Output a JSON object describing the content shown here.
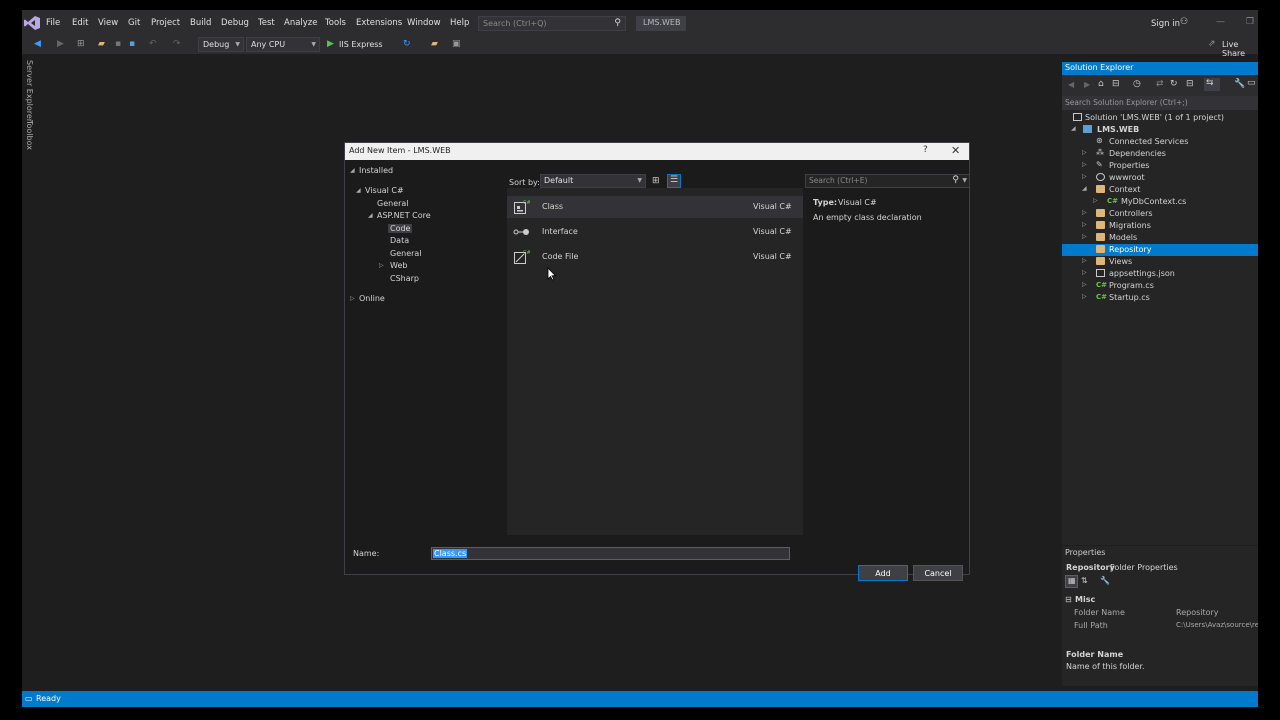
{
  "menubar": {
    "items": [
      "File",
      "Edit",
      "View",
      "Git",
      "Project",
      "Build",
      "Debug",
      "Test",
      "Analyze",
      "Tools",
      "Extensions",
      "Window",
      "Help"
    ],
    "search_placeholder": "Search (Ctrl+Q)",
    "solution_name": "LMS.WEB",
    "sign_in": "Sign in"
  },
  "toolbar": {
    "config": "Debug",
    "platform": "Any CPU",
    "run_target": "IIS Express",
    "live_share": "Live Share"
  },
  "side_tabs": [
    "Server Explorer",
    "Toolbox"
  ],
  "solution_explorer": {
    "title": "Solution Explorer",
    "search_placeholder": "Search Solution Explorer (Ctrl+;)",
    "solution": "Solution 'LMS.WEB' (1 of 1 project)",
    "project": "LMS.WEB",
    "items": [
      {
        "label": "Connected Services",
        "icon": "connected-services-icon"
      },
      {
        "label": "Dependencies",
        "icon": "dependencies-icon"
      },
      {
        "label": "Properties",
        "icon": "wrench-icon"
      },
      {
        "label": "wwwroot",
        "icon": "globe-icon"
      },
      {
        "label": "Context",
        "icon": "folder-icon"
      },
      {
        "label": "MyDbContext.cs",
        "icon": "csharp-file-icon"
      },
      {
        "label": "Controllers",
        "icon": "folder-icon"
      },
      {
        "label": "Migrations",
        "icon": "folder-icon"
      },
      {
        "label": "Models",
        "icon": "folder-icon"
      },
      {
        "label": "Repository",
        "icon": "folder-icon"
      },
      {
        "label": "Views",
        "icon": "folder-icon"
      },
      {
        "label": "appsettings.json",
        "icon": "json-file-icon"
      },
      {
        "label": "Program.cs",
        "icon": "csharp-file-icon"
      },
      {
        "label": "Startup.cs",
        "icon": "csharp-file-icon"
      }
    ],
    "selected": "Repository"
  },
  "properties": {
    "title": "Properties",
    "object": "Repository",
    "object_type": "Folder Properties",
    "category": "Misc",
    "rows": [
      {
        "name": "Folder Name",
        "value": "Repository"
      },
      {
        "name": "Full Path",
        "value": "C:\\Users\\Avaz\\source\\re"
      }
    ],
    "desc_title": "Folder Name",
    "desc_text": "Name of this folder."
  },
  "status": {
    "text": "Ready"
  },
  "dialog": {
    "title": "Add New Item - LMS.WEB",
    "help": "?",
    "close": "✕",
    "tree": {
      "installed": "Installed",
      "visual_csharp": "Visual C#",
      "general": "General",
      "aspnet_core": "ASP.NET Core",
      "code": "Code",
      "data": "Data",
      "general2": "General",
      "web": "Web",
      "csharp": "CSharp",
      "online": "Online"
    },
    "sort_by_label": "Sort by:",
    "sort_by_value": "Default",
    "search_placeholder": "Search (Ctrl+E)",
    "templates": [
      {
        "name": "Class",
        "lang": "Visual C#",
        "icon": "class-icon"
      },
      {
        "name": "Interface",
        "lang": "Visual C#",
        "icon": "interface-icon"
      },
      {
        "name": "Code File",
        "lang": "Visual C#",
        "icon": "code-file-icon"
      }
    ],
    "type_label": "Type:",
    "type_value": "Visual C#",
    "description": "An empty class declaration",
    "name_label": "Name:",
    "name_value": "Class.cs",
    "add": "Add",
    "cancel": "Cancel"
  }
}
